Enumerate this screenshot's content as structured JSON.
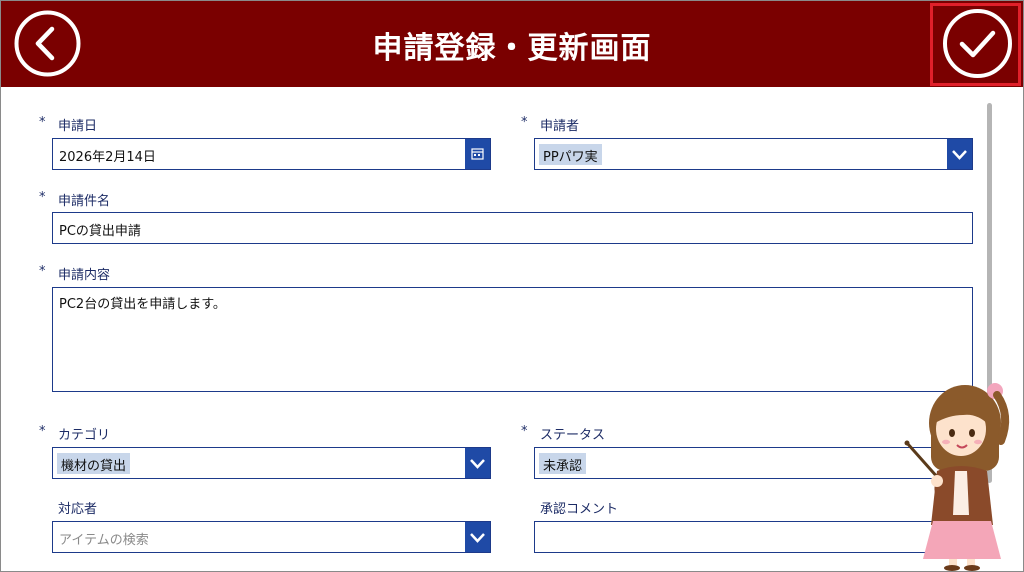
{
  "header": {
    "title": "申請登録・更新画面",
    "back_icon": "chevron-left-circle-icon",
    "submit_icon": "check-circle-icon"
  },
  "form": {
    "application_date": {
      "label": "申請日",
      "required": "*",
      "value": "2026年2月14日"
    },
    "applicant": {
      "label": "申請者",
      "required": "*",
      "value": "PPパワ実"
    },
    "subject": {
      "label": "申請件名",
      "required": "*",
      "value": "PCの貸出申請"
    },
    "content": {
      "label": "申請内容",
      "required": "*",
      "value": "PC2台の貸出を申請します。"
    },
    "category": {
      "label": "カテゴリ",
      "required": "*",
      "value": "機材の貸出"
    },
    "status": {
      "label": "ステータス",
      "required": "*",
      "value": "未承認"
    },
    "handler": {
      "label": "対応者",
      "placeholder": "アイテムの検索"
    },
    "approval_comment": {
      "label": "承認コメント",
      "value": ""
    }
  },
  "colors": {
    "header_bg": "#7a0000",
    "accent": "#1f4aa6",
    "highlight": "#e0202a",
    "label": "#1d2c66"
  }
}
